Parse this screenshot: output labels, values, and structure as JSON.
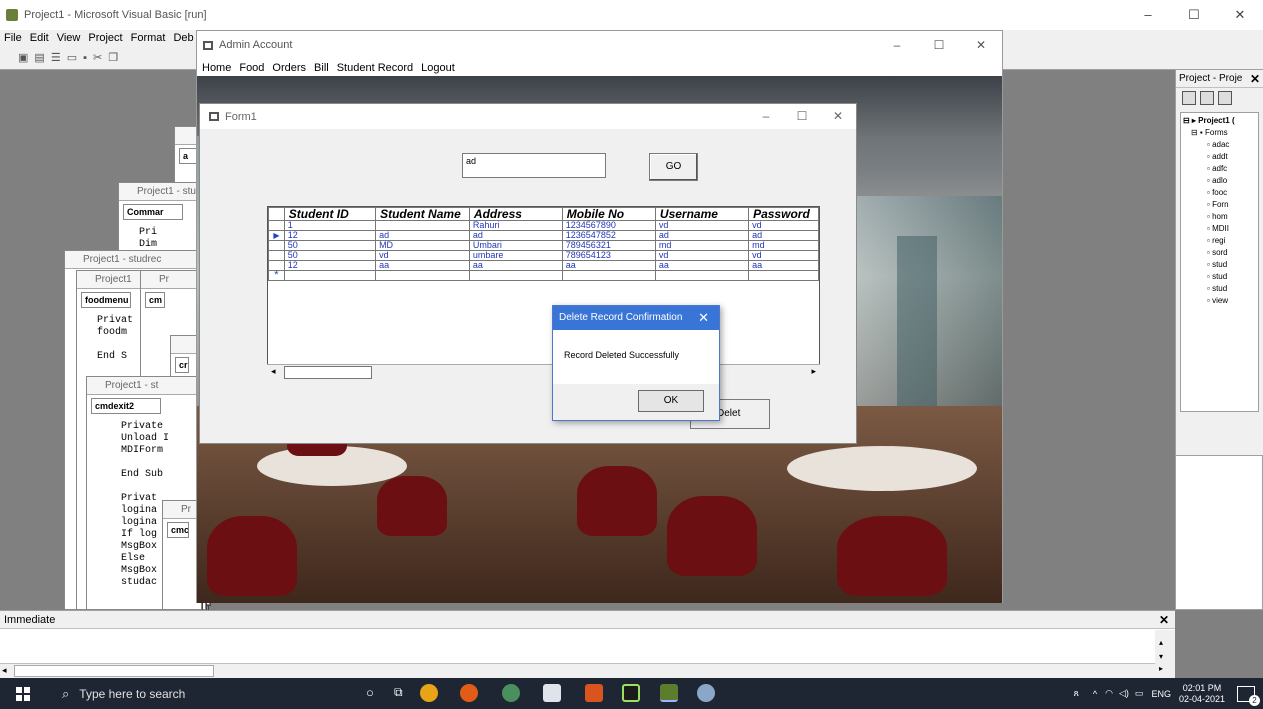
{
  "ide": {
    "title": "Project1 - Microsoft Visual Basic [run]",
    "menu": [
      "File",
      "Edit",
      "View",
      "Project",
      "Format",
      "Deb"
    ],
    "toolbar_icons": [
      "add-project-icon",
      "add-form-icon",
      "menu-editor-icon",
      "open-icon",
      "save-icon",
      "cut-icon",
      "copy-icon",
      "paste-icon"
    ]
  },
  "code_windows": [
    {
      "title": "Project1 - stu",
      "combo": "Commar",
      "lines": [
        "Pri",
        "Dim"
      ]
    },
    {
      "title": "Project1 - studrec",
      "combo": "",
      "lines": []
    },
    {
      "title": "Project1",
      "combo": "foodmenu",
      "lines": [
        "Privat",
        "foodm",
        "",
        "End S"
      ]
    },
    {
      "title": "Project1 - st",
      "combo": "cmdexit2",
      "lines": [
        "Private",
        "Unload I",
        "MDIForm",
        "",
        "End Sub",
        "",
        "Privat",
        "logina",
        "logina",
        "If log",
        "MsgBox",
        "Else",
        "MsgBox",
        "studac"
      ]
    },
    {
      "title": "Pr",
      "combo": "cm",
      "lines": []
    },
    {
      "title": "",
      "combo": "cr",
      "lines": []
    },
    {
      "title": "Pr",
      "combo": "cmc",
      "lines": []
    },
    {
      "title": "",
      "combo": "a",
      "lines": []
    }
  ],
  "project_explorer": {
    "title": "Project - Proje",
    "tree": [
      "Project1 (",
      "Forms",
      "adac",
      "addt",
      "adfc",
      "adlo",
      "fooc",
      "Forn",
      "hom",
      "MDII",
      "regi",
      "sord",
      "stud",
      "stud",
      "stud",
      "view"
    ]
  },
  "immediate": {
    "title": "Immediate"
  },
  "admin": {
    "title": "Admin Account",
    "menu": [
      "Home",
      "Food",
      "Orders",
      "Bill",
      "Student Record",
      "Logout"
    ]
  },
  "form1": {
    "title": "Form1",
    "search_value": "ad",
    "go_label": "GO",
    "delete_label": "Delet",
    "grid": {
      "columns": [
        "Student ID",
        "Student Name",
        "Address",
        "Mobile No",
        "Username",
        "Password"
      ],
      "rows": [
        [
          "1",
          "",
          "Rahuri",
          "1234567890",
          "vd",
          "vd"
        ],
        [
          "12",
          "ad",
          "ad",
          "1236547852",
          "ad",
          "ad"
        ],
        [
          "50",
          "MD",
          "Umbari",
          "789456321",
          "md",
          "md"
        ],
        [
          "50",
          "vd",
          "umbare",
          "789654123",
          "vd",
          "vd"
        ],
        [
          "12",
          "aa",
          "aa",
          "aa",
          "aa",
          "aa"
        ]
      ],
      "new_row_marker": "*",
      "current_row_marker": "▶"
    }
  },
  "dialog": {
    "title": "Delete Record Confirmation",
    "message": "Record Deleted Successfully",
    "ok_label": "OK"
  },
  "taskbar": {
    "search_placeholder": "Type here to search",
    "lang": "ENG",
    "time": "02:01 PM",
    "date": "02-04-2021",
    "notifications": "2"
  },
  "colors": {
    "taskbar": "#1e2533",
    "dialog_title": "#3875d7",
    "grid_text": "#2036b8"
  }
}
